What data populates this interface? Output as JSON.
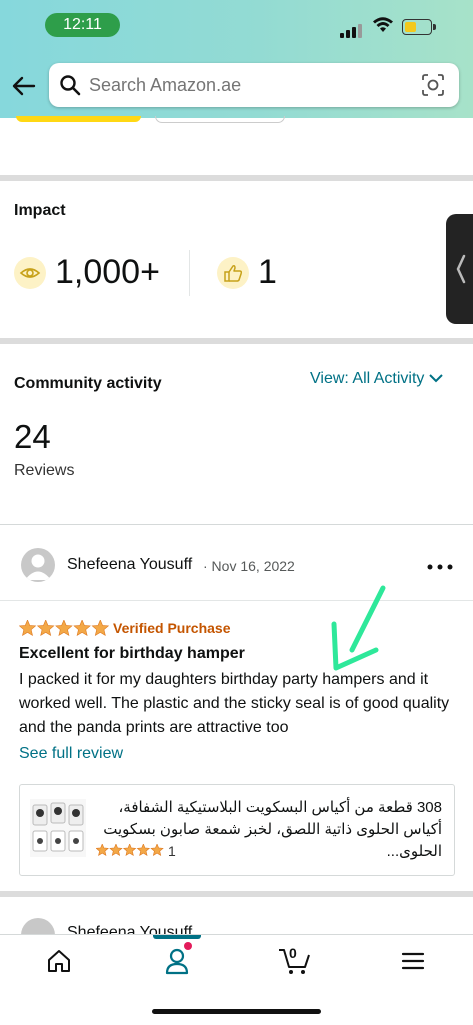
{
  "status_bar": {
    "time": "12:11"
  },
  "search": {
    "placeholder": "Search Amazon.ae"
  },
  "impact": {
    "title": "Impact",
    "views": "1,000+",
    "likes": "1"
  },
  "community": {
    "title": "Community activity",
    "view_prefix": "View:",
    "view_value": "All Activity",
    "review_count": "24",
    "reviews_label": "Reviews"
  },
  "review": {
    "reviewer": "Shefeena Yousuff",
    "date": "· Nov 16, 2022",
    "stars": 5,
    "verified": "Verified Purchase",
    "title": "Excellent for birthday hamper",
    "body": "I packed it for my daughters birthday party hampers and it worked well. The plastic and the sticky seal is of good quality and the panda prints are attractive too",
    "see_full": "See full review"
  },
  "product": {
    "title": "308 قطعة من أكياس البسكويت البلاستيكية الشفافة، أكياس الحلوى ذاتية اللصق، لخبز شمعة صابون بسكويت الحلوى...",
    "stars": 5,
    "rating_count": "1"
  },
  "next_review": {
    "reviewer": "Shefeena Yousuff"
  },
  "bottom_nav": {
    "cart_count": "0"
  },
  "colors": {
    "link": "#007185",
    "verified": "#c45500",
    "star": "#f3a847",
    "annotation_arrow": "#2ee89a"
  }
}
